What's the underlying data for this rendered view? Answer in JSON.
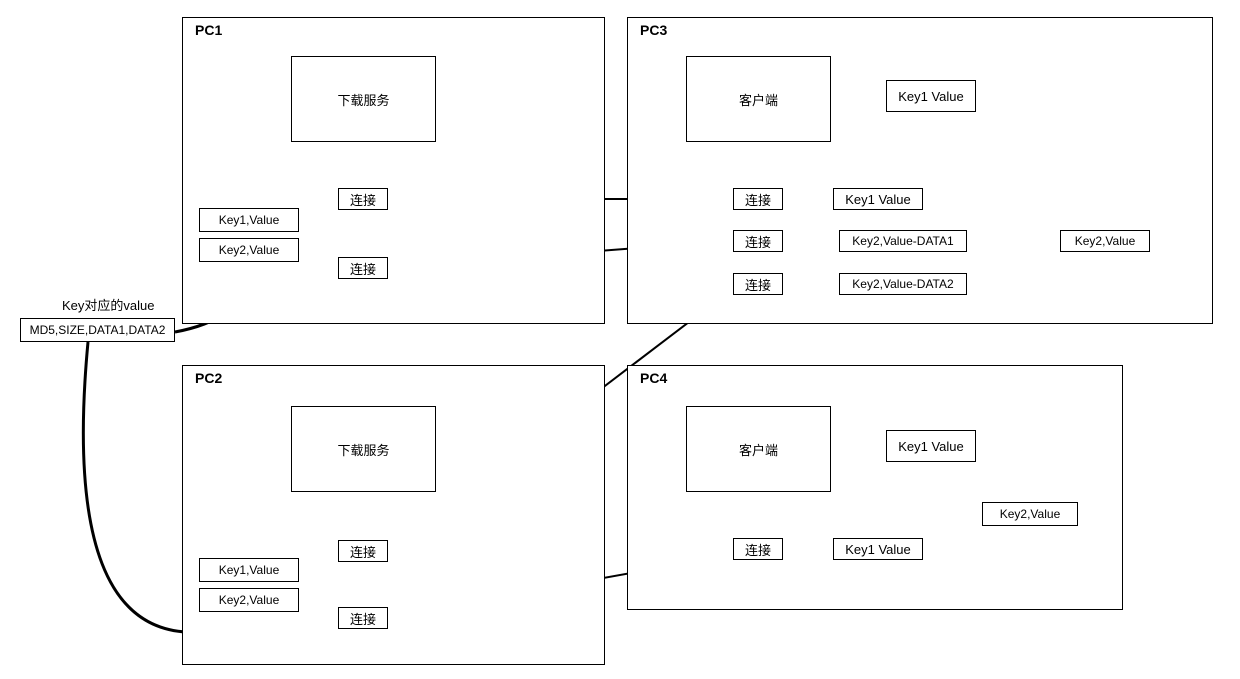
{
  "pc1": {
    "label": "PC1",
    "service": "下载服务",
    "conn1": "连接",
    "conn2": "连接",
    "db_row1": "Key1,Value",
    "db_row2": "Key2,Value"
  },
  "pc2": {
    "label": "PC2",
    "service": "下载服务",
    "conn1": "连接",
    "conn2": "连接",
    "db_row1": "Key1,Value",
    "db_row2": "Key2,Value"
  },
  "pc3": {
    "label": "PC3",
    "client": "客户端",
    "key1_top": "Key1 Value",
    "conn1": "连接",
    "key1_mid": "Key1 Value",
    "conn2": "连接",
    "key2data1": "Key2,Value-DATA1",
    "key2value": "Key2,Value",
    "conn3": "连接",
    "key2data2": "Key2,Value-DATA2"
  },
  "pc4": {
    "label": "PC4",
    "client": "客户端",
    "key1_top": "Key1 Value",
    "conn1": "连接",
    "key1_mid": "Key1 Value",
    "db_row": "Key2,Value"
  },
  "side": {
    "title": "Key对应的value",
    "value": "MD5,SIZE,DATA1,DATA2"
  }
}
